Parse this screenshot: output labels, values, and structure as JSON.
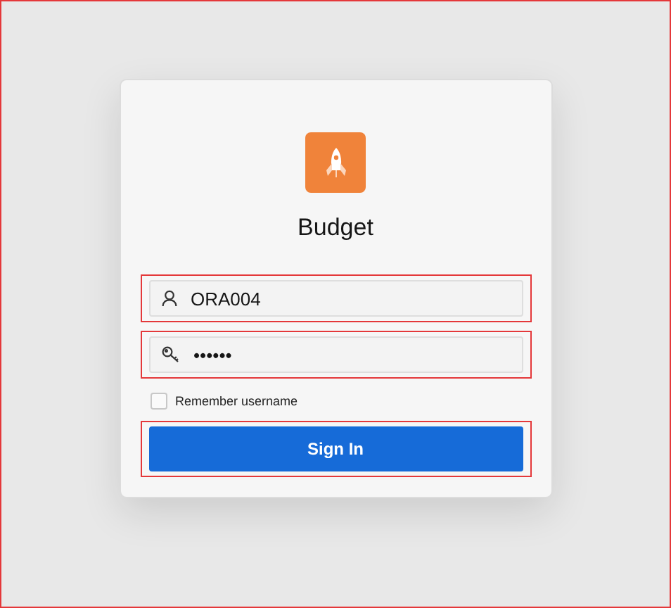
{
  "app": {
    "title": "Budget"
  },
  "fields": [
    {
      "kind": "user",
      "value": "ORA004"
    },
    {
      "kind": "password",
      "value": "••••••"
    }
  ],
  "remember": {
    "label": "Remember username",
    "checked": false
  },
  "sign_in": {
    "label": "Sign In"
  }
}
